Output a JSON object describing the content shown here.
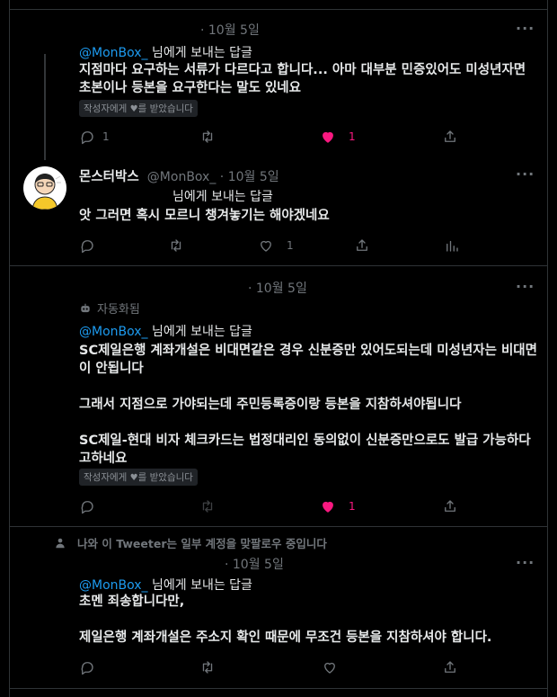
{
  "tweet1": {
    "date": "· 10월 5일",
    "mention": "@MonBox_",
    "reply_suffix": "님에게 보내는 답글",
    "text": "지점마다 요구하는 서류가 다르다고 합니다... 아마 대부분 민증있어도 미성년자면 초본이나 등본을 요구한다는 말도 있네요",
    "badge_prefix": "작성자에게",
    "badge_suffix": "를 받았습니다",
    "reply_count": "1",
    "like_count": "1"
  },
  "tweet2": {
    "author_name": "몬스터박스",
    "handle_date": "@MonBox_ · 10월 5일",
    "reply_suffix": "님에게 보내는 답글",
    "text": "앗 그러면 혹시 모르니 챙겨놓기는 해야겠네요",
    "like_count": "1"
  },
  "tweet3": {
    "date": "· 10월 5일",
    "auto_label": "자동화됨",
    "mention": "@MonBox_",
    "reply_suffix": "님에게 보내는 답글",
    "text": "SC제일은행 계좌개설은 비대면같은 경우 신분증만 있어도되는데 미성년자는 비대면이 안됩니다\n\n그래서 지점으로 가야되는데 주민등록증이랑 등본을 지참하셔야됩니다\n\nSC제일-현대 비자 체크카드는 법정대리인 동의없이 신분증만으로도 발급 가능하다고하네요",
    "badge_prefix": "작성자에게",
    "badge_suffix": "를 받았습니다",
    "like_count": "1"
  },
  "tweet4": {
    "social_context": "나와 이 Tweeter는 일부 계정을 맞팔로우 중입니다",
    "date": "· 10월 5일",
    "mention": "@MonBox_",
    "reply_suffix": "님에게 보내는 답글",
    "text": "초멘 죄송합니다만,\n\n제일은행 계좌개설은 주소지 확인 때문에 무조건 등본을 지참하셔야 합니다."
  },
  "colors": {
    "background": "#000000",
    "text": "#e7e9ea",
    "muted": "#71767b",
    "accent": "#1d9bf0",
    "like": "#f91880",
    "border": "#2f3336"
  },
  "icons": [
    "reply-icon",
    "retweet-icon",
    "heart-icon",
    "share-icon",
    "analytics-icon",
    "more-icon",
    "robot-icon",
    "person-icon"
  ]
}
